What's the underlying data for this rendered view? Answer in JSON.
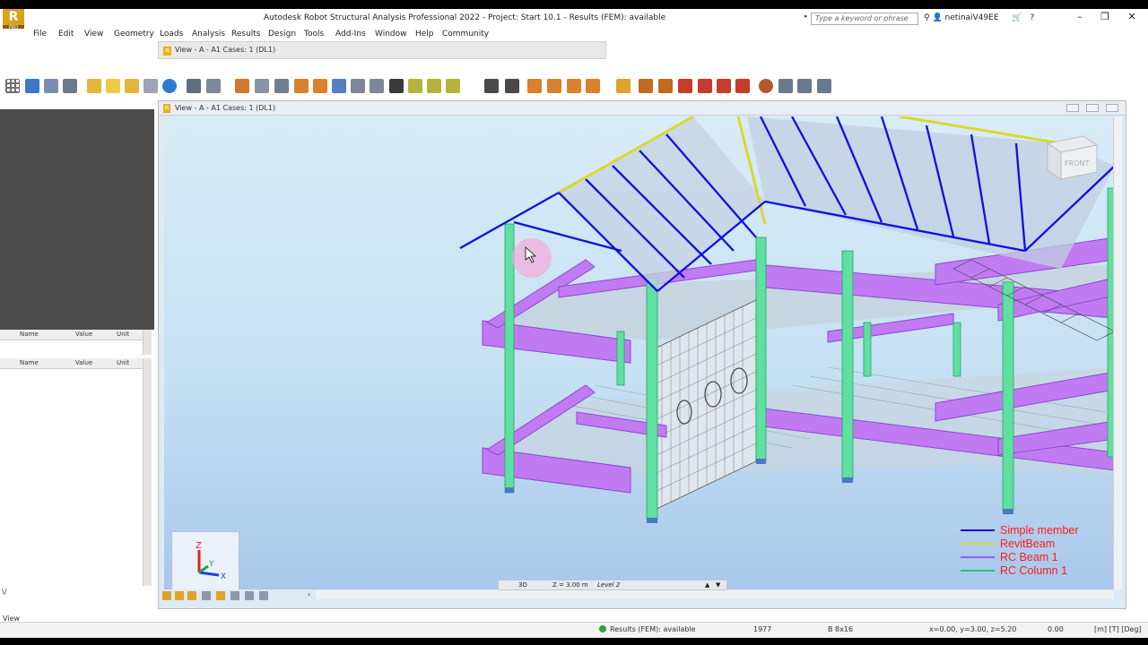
{
  "window": {
    "title": "Autodesk Robot Structural Analysis Professional 2022 - Project: Start 10.1 - Results (FEM): available",
    "logo_letter": "R",
    "logo_badge": "PRO",
    "search_placeholder": "Type a keyword or phrase",
    "user": "netinaiV49EE"
  },
  "menu": [
    "File",
    "Edit",
    "View",
    "Geometry",
    "Loads",
    "Analysis",
    "Results",
    "Design",
    "Tools",
    "Add-Ins",
    "Window",
    "Help",
    "Community"
  ],
  "tab": {
    "label": "View - A - A1 Cases: 1 (DL1)",
    "icon_letter": "R"
  },
  "view": {
    "title": "View - A - A1 Cases: 1 (DL1)",
    "mode": "3D",
    "level": "Z = 3.00 m",
    "level_name": "Level 2",
    "navcube_label": "FRONT",
    "axis_labels": {
      "z": "Z",
      "y": "Y",
      "x": "X"
    }
  },
  "legend": [
    {
      "label": "Simple member",
      "color": "#0a0ad8"
    },
    {
      "label": "RevitBeam",
      "color": "#d9d92c"
    },
    {
      "label": "RC Beam 1",
      "color": "#9b5cf5"
    },
    {
      "label": "RC Column 1",
      "color": "#27c47a"
    }
  ],
  "properties": {
    "col_name": "Name",
    "col_value": "Value",
    "col_unit": "Unit"
  },
  "statusbar": {
    "results": "Results (FEM): available",
    "count": "1977",
    "section": "B 8x16",
    "coords": "x=0.00, y=3.00, z=5.20",
    "value": "0.00",
    "units": "[m] [T] [Deg]",
    "view_label": "View"
  }
}
